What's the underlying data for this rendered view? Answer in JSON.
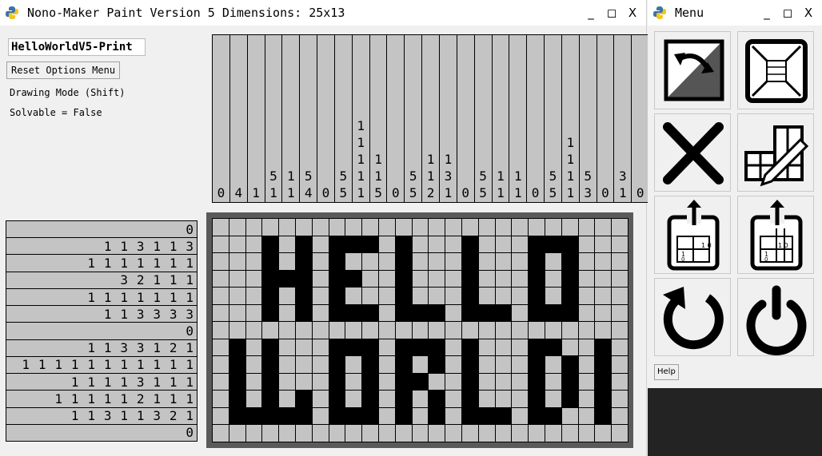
{
  "main_window": {
    "title": "Nono-Maker Paint Version 5 Dimensions: 25x13",
    "minimize": "_",
    "maximize": "◻",
    "close": "X",
    "name_value": "HelloWorldV5-Print",
    "reset_button": "Reset Options Menu",
    "drawing_mode": "Drawing Mode (Shift)",
    "solvable": "Solvable = False"
  },
  "menu_window": {
    "title": "Menu",
    "minimize": "_",
    "maximize": "◻",
    "close": "X",
    "help_button": "Help",
    "icons": [
      "swap-colors-icon",
      "resize-grid-icon",
      "clear-icon",
      "edit-icon",
      "export-icon",
      "export-solution-icon",
      "restart-icon",
      "power-icon"
    ]
  },
  "column_clues": [
    [
      "0"
    ],
    [
      "4"
    ],
    [
      "1"
    ],
    [
      "5",
      "1"
    ],
    [
      "1",
      "1"
    ],
    [
      "5",
      "4"
    ],
    [
      "0"
    ],
    [
      "5",
      "5"
    ],
    [
      "1",
      "1",
      "1",
      "1",
      "1"
    ],
    [
      "1",
      "1",
      "5"
    ],
    [
      "0"
    ],
    [
      "5",
      "5"
    ],
    [
      "1",
      "1",
      "2"
    ],
    [
      "1",
      "3",
      "1"
    ],
    [
      "0"
    ],
    [
      "5",
      "5"
    ],
    [
      "1",
      "1"
    ],
    [
      "1",
      "1"
    ],
    [
      "0"
    ],
    [
      "5",
      "5"
    ],
    [
      "1",
      "1",
      "1",
      "1"
    ],
    [
      "5",
      "3"
    ],
    [
      "0"
    ],
    [
      "3",
      "1"
    ],
    [
      "0"
    ]
  ],
  "row_clues": [
    [
      "0"
    ],
    [
      "1",
      "1",
      "3",
      "1",
      "1",
      "3"
    ],
    [
      "1",
      "1",
      "1",
      "1",
      "1",
      "1",
      "1"
    ],
    [
      "3",
      "2",
      "1",
      "1",
      "1"
    ],
    [
      "1",
      "1",
      "1",
      "1",
      "1",
      "1",
      "1"
    ],
    [
      "1",
      "1",
      "3",
      "3",
      "3",
      "3"
    ],
    [
      "0"
    ],
    [
      "1",
      "1",
      "3",
      "3",
      "1",
      "2",
      "1"
    ],
    [
      "1",
      "1",
      "1",
      "1",
      "1",
      "1",
      "1",
      "1",
      "1",
      "1",
      "1"
    ],
    [
      "1",
      "1",
      "1",
      "1",
      "3",
      "1",
      "1",
      "1"
    ],
    [
      "1",
      "1",
      "1",
      "1",
      "1",
      "2",
      "1",
      "1",
      "1"
    ],
    [
      "1",
      "1",
      "3",
      "1",
      "1",
      "3",
      "2",
      "1"
    ],
    [
      "0"
    ]
  ],
  "grid_rows": [
    "0000000000000000000000000",
    "0001010111010001000111000",
    "0001010100010001000101000",
    "0001110110010001000101000",
    "0001010100010001000101000",
    "0001010111011101110111000",
    "0000000000000000000000000",
    "0101000111011101000110010",
    "0101000101010101000101010",
    "0101000101011001000101010",
    "0101010101010101000101010",
    "0111110111010101110110010",
    "0000000000000000000000000"
  ],
  "colors": {
    "filled": "#000000",
    "empty": "#c4c4c4",
    "frame": "#5a5a5a"
  }
}
